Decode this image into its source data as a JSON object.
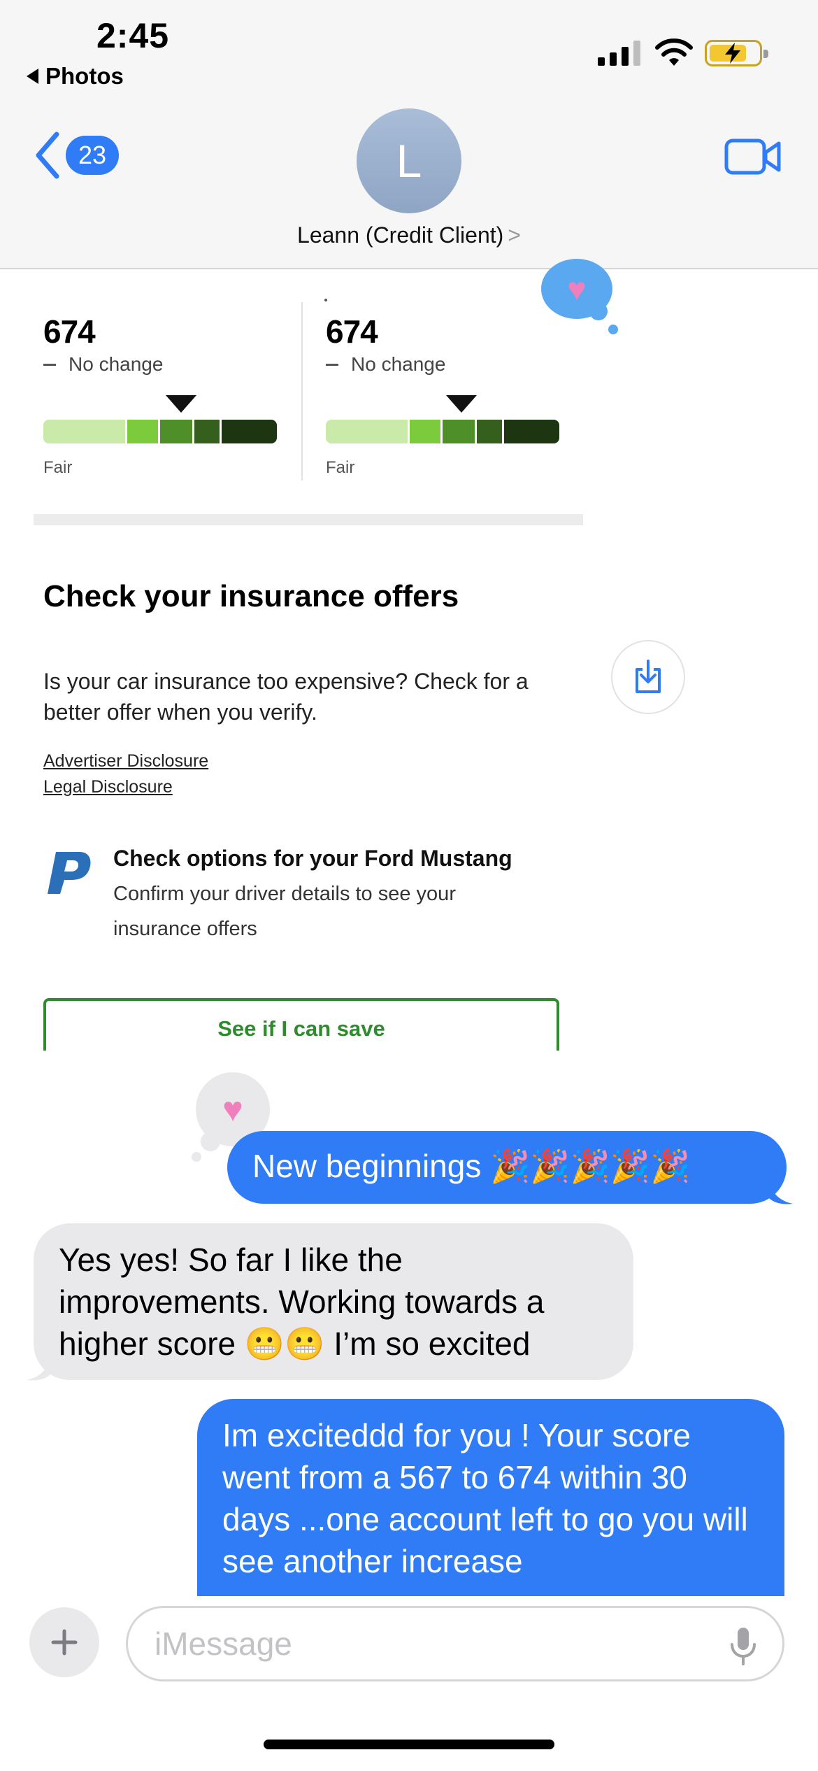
{
  "status_bar": {
    "time": "2:45",
    "back_app": "Photos"
  },
  "header": {
    "unread_count": "23",
    "avatar_initial": "L",
    "contact_name": "Leann (Credit Client)",
    "contact_chevron": ">"
  },
  "attachment": {
    "scores": [
      {
        "value": "674",
        "change": "No change",
        "rating": "Fair"
      },
      {
        "value": "674",
        "change": "No change",
        "rating": "Fair"
      }
    ],
    "insurance": {
      "title": "Check your insurance offers",
      "body": "Is your car insurance too expensive? Check for a better offer when you verify.",
      "advertiser_disclosure": "Advertiser Disclosure",
      "legal_disclosure": "Legal Disclosure",
      "option_title": "Check options for your Ford Mustang",
      "option_body": "Confirm your driver details to see your insurance offers",
      "button_label": "See if I can save"
    },
    "tapback": "heart",
    "colors": {
      "button_green": "#2e8b2e",
      "bar": [
        "#c9eaa8",
        "#7ccb3c",
        "#4f8f2a",
        "#345f1c",
        "#1d3510"
      ]
    }
  },
  "messages": [
    {
      "from": "me",
      "text": "New beginnings 🎉🎉🎉🎉🎉",
      "tapback": "heart"
    },
    {
      "from": "them",
      "text": "Yes yes! So far I like the improvements. Working towards a higher score 😬😬 I’m so excited"
    },
    {
      "from": "me",
      "text": "Im exciteddd for you ! Your score went from a 567 to 674 within 30 days ...one account left to go you will see another increase"
    }
  ],
  "composer": {
    "placeholder": "iMessage"
  },
  "colors": {
    "imessage_blue": "#2f7cf6",
    "received_gray": "#e9e9eb",
    "header_bg": "#f6f6f6"
  }
}
